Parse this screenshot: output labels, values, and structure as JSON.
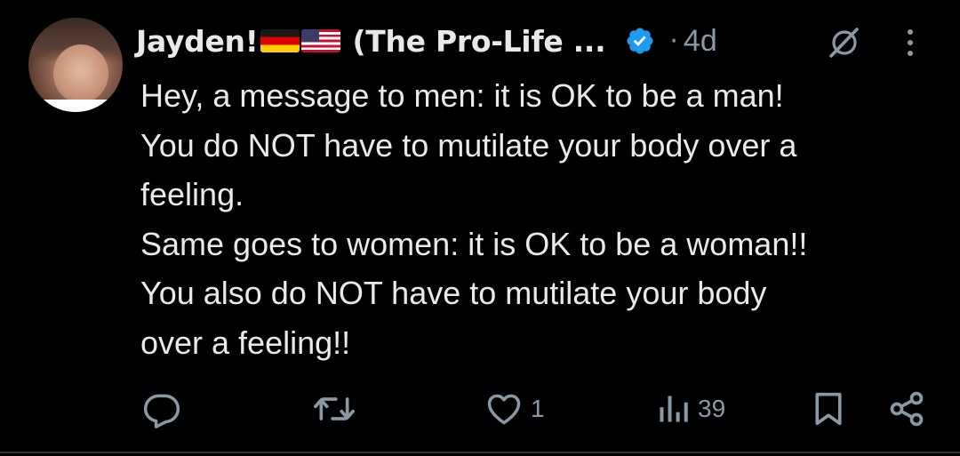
{
  "author": {
    "name_prefix": "Jayden!",
    "name_suffix": "(The Pro-Life ...",
    "flags": [
      "germany-flag",
      "usa-flag"
    ],
    "verified": true,
    "time_separator": "·",
    "time": "4d"
  },
  "tweet": {
    "lines": [
      "Hey, a message to men: it is OK to be a man!",
      "You do NOT have to mutilate your body over a",
      "feeling.",
      "Same goes to women: it is OK to be a woman!!",
      "You also do NOT have to mutilate your body",
      "over a feeling!!"
    ]
  },
  "actions": {
    "reply": {
      "icon": "reply-icon",
      "count": ""
    },
    "repost": {
      "icon": "repost-icon",
      "count": ""
    },
    "like": {
      "icon": "heart-icon",
      "count": "1"
    },
    "views": {
      "icon": "views-icon",
      "count": "39"
    },
    "bookmark": {
      "icon": "bookmark-icon"
    },
    "share": {
      "icon": "share-icon"
    }
  },
  "colors": {
    "background": "#000000",
    "text": "#e7e9ea",
    "muted": "#8b98a5",
    "verified": "#1d9bf0"
  }
}
